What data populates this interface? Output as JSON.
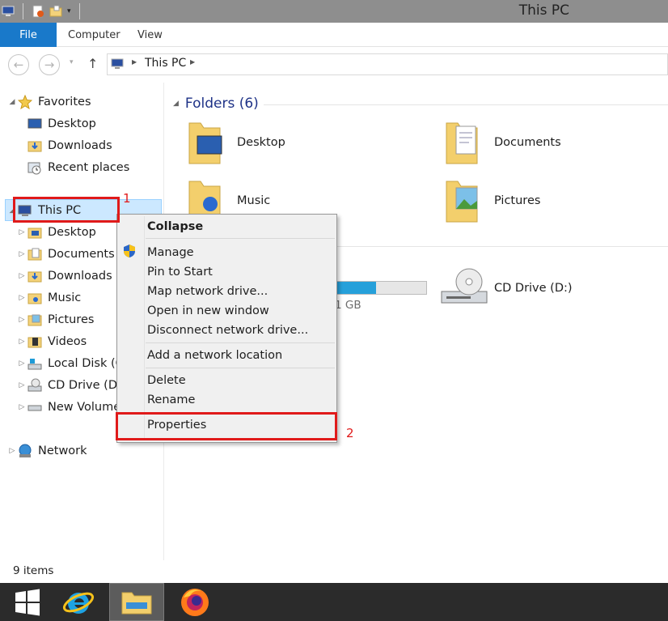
{
  "window": {
    "title": "This PC"
  },
  "ribbon": {
    "tabs": [
      "File",
      "Computer",
      "View"
    ]
  },
  "address": {
    "crumb": "This PC"
  },
  "navpane": {
    "favorites_label": "Favorites",
    "favorites": [
      "Desktop",
      "Downloads",
      "Recent places"
    ],
    "thispc_label": "This PC",
    "thispc_items": [
      "Desktop",
      "Documents",
      "Downloads",
      "Music",
      "Pictures",
      "Videos",
      "Local Disk (C",
      "CD Drive (D:)",
      "New Volume"
    ],
    "network_label": "Network"
  },
  "content": {
    "folders_header": "Folders (6)",
    "folders": [
      "Desktop",
      "Documents",
      "Music",
      "Pictures"
    ],
    "drive_partial_label": "1 GB",
    "drive_fill_fraction": 0.45,
    "cd_drive": "CD Drive (D:)"
  },
  "status": {
    "items": "9 items"
  },
  "context_menu": {
    "collapse": "Collapse",
    "manage": "Manage",
    "pin_to_start": "Pin to Start",
    "map_network_drive": "Map network drive...",
    "open_new_window": "Open in new window",
    "disconnect_network_drive": "Disconnect network drive...",
    "add_network_location": "Add a network location",
    "delete": "Delete",
    "rename": "Rename",
    "properties": "Properties"
  },
  "annotations": {
    "first": "1",
    "second": "2"
  },
  "colors": {
    "accent": "#1979ca",
    "annotation": "#e01a1a",
    "selection": "#cce8ff"
  }
}
